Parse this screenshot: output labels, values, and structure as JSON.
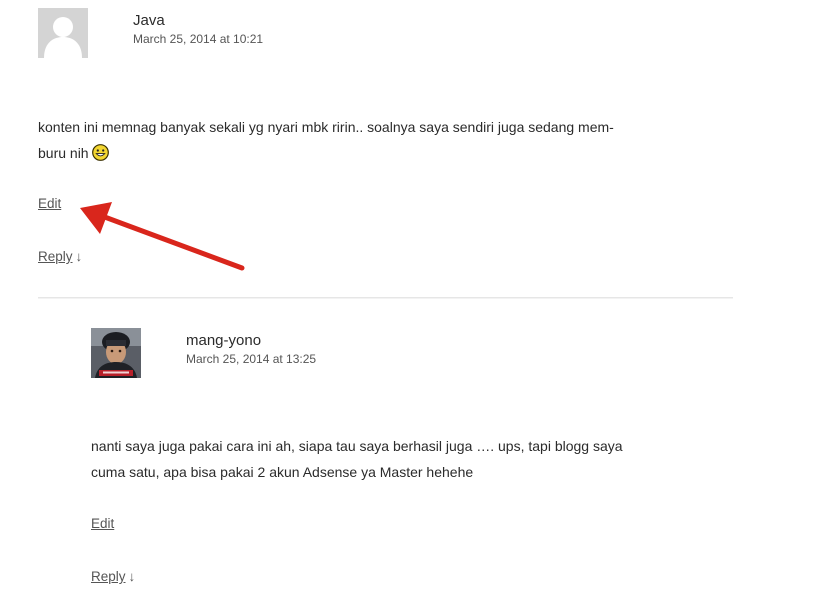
{
  "comments": [
    {
      "author": "Java",
      "date": "March 25, 2014 at 10:21",
      "body_line1": "konten ini memnag banyak sekali yg nyari mbk ririn.. soalnya saya sendiri juga sedang mem-",
      "body_line2": "buru nih",
      "edit_label": "Edit",
      "reply_label": "Reply",
      "reply_arrow": "↓",
      "avatar_icon": "default-avatar-icon"
    },
    {
      "author": "mang-yono",
      "date": "March 25, 2014 at 13:25",
      "body_line1": "nanti saya juga pakai cara ini ah, siapa tau saya berhasil juga …. ups, tapi blogg saya",
      "body_line2": "cuma satu, apa bisa pakai 2 akun Adsense ya Master hehehe",
      "edit_label": "Edit",
      "reply_label": "Reply",
      "reply_arrow": "↓",
      "avatar_icon": "user-photo-avatar"
    }
  ],
  "colors": {
    "annotation_arrow": "#d9261c",
    "link": "#555555",
    "text": "#2b2b2b"
  }
}
